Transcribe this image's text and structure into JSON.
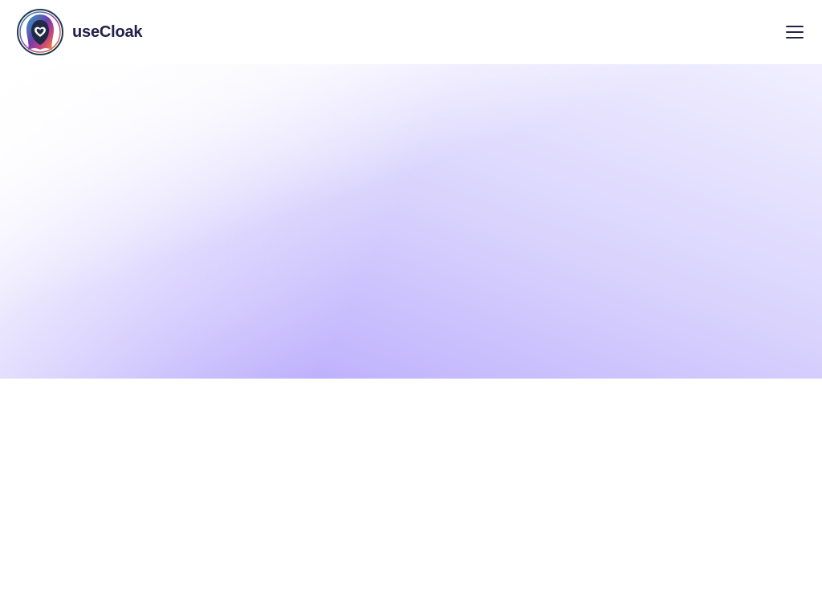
{
  "header": {
    "brand_name": "useCloak",
    "logo_icon": "hooded-figure-heart-logo",
    "menu_icon": "hamburger-menu-icon"
  },
  "colors": {
    "brand_text": "#24204a",
    "hero_gradient_start": "#ffffff",
    "hero_gradient_end": "#ab9bfb"
  }
}
